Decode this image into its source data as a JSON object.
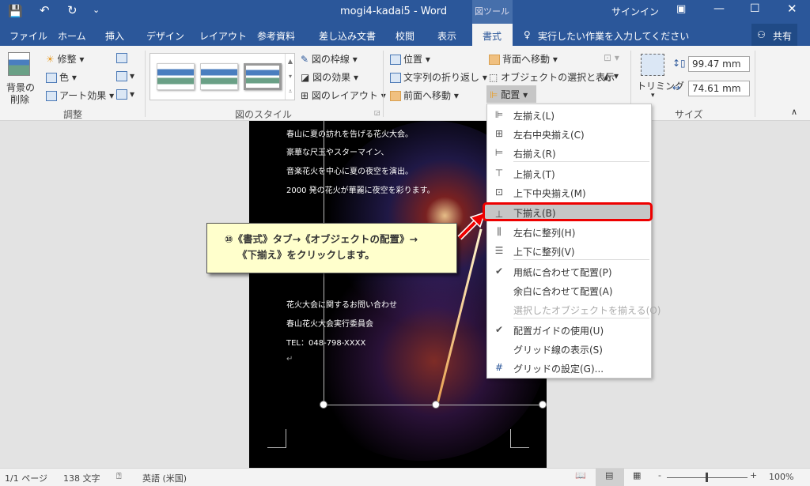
{
  "titlebar": {
    "title": "mogi4-kadai5 - Word",
    "context_tab": "図ツール",
    "signin": "サインイン",
    "colors": {
      "brand": "#2b579a"
    }
  },
  "tabs": [
    {
      "label": "ファイル"
    },
    {
      "label": "ホーム"
    },
    {
      "label": "挿入"
    },
    {
      "label": "デザイン"
    },
    {
      "label": "レイアウト"
    },
    {
      "label": "参考資料"
    },
    {
      "label": "差し込み文書"
    },
    {
      "label": "校閲"
    },
    {
      "label": "表示"
    },
    {
      "label": "書式",
      "active": true
    }
  ],
  "tellme": "実行したい作業を入力してください",
  "share": "共有",
  "ribbon": {
    "adjust": {
      "remove_bg": [
        "背景の",
        "削除"
      ],
      "corrections": "修整",
      "color": "色",
      "art": "アート効果",
      "group": "調整"
    },
    "styles": {
      "border": "図の枠線",
      "effects": "図の効果",
      "layout": "図のレイアウト",
      "group": "図のスタイル"
    },
    "arrange": {
      "position": "位置",
      "wrap": "文字列の折り返し",
      "forward": "前面へ移動",
      "backward": "背面へ移動",
      "selection": "オブジェクトの選択と表示",
      "align": "配置"
    },
    "size": {
      "crop": "トリミング",
      "height": "99.47 mm",
      "width": "74.61 mm",
      "group": "サイズ"
    }
  },
  "document": {
    "lines": [
      "春山に夏の訪れを告げる花火大会。",
      "豪華な尺玉やスターマイン、",
      "音楽花火を中心に夏の夜空を演出。",
      "2000 発の花火が華麗に夜空を彩ります。",
      "花火大会に関するお問い合わせ",
      "春山花火大会実行委員会",
      "TEL：048-798-XXXX"
    ]
  },
  "callout": {
    "line1": "⑩《書式》タブ→《オブジェクトの配置》→",
    "line2": "《下揃え》をクリックします。"
  },
  "menu": {
    "items": [
      {
        "label": "左揃え(L)",
        "icon": "align-left-icon",
        "glyph": "⊫"
      },
      {
        "label": "左右中央揃え(C)",
        "icon": "align-center-icon",
        "glyph": "⊞"
      },
      {
        "label": "右揃え(R)",
        "icon": "align-right-icon",
        "glyph": "⊨"
      },
      {
        "label": "上揃え(T)",
        "icon": "align-top-icon",
        "glyph": "⊤"
      },
      {
        "label": "上下中央揃え(M)",
        "icon": "align-middle-icon",
        "glyph": "⊡"
      },
      {
        "label": "下揃え(B)",
        "icon": "align-bottom-icon",
        "glyph": "⊥",
        "highlighted": true
      },
      {
        "label": "左右に整列(H)",
        "icon": "distribute-horizontal-icon",
        "glyph": "⫼"
      },
      {
        "label": "上下に整列(V)",
        "icon": "distribute-vertical-icon",
        "glyph": "☰"
      },
      {
        "label": "用紙に合わせて配置(P)",
        "icon": "check-icon",
        "glyph": "✔"
      },
      {
        "label": "余白に合わせて配置(A)",
        "icon": "",
        "glyph": ""
      },
      {
        "label": "選択したオブジェクトを揃える(O)",
        "icon": "",
        "glyph": "",
        "disabled": true
      },
      {
        "label": "配置ガイドの使用(U)",
        "icon": "check-icon",
        "glyph": "✔"
      },
      {
        "label": "グリッド線の表示(S)",
        "icon": "",
        "glyph": ""
      },
      {
        "label": "グリッドの設定(G)...",
        "icon": "grid-icon",
        "glyph": "#"
      }
    ]
  },
  "status": {
    "page": "1/1 ページ",
    "words": "138 文字",
    "lang": "英語 (米国)",
    "zoom": "100%"
  }
}
